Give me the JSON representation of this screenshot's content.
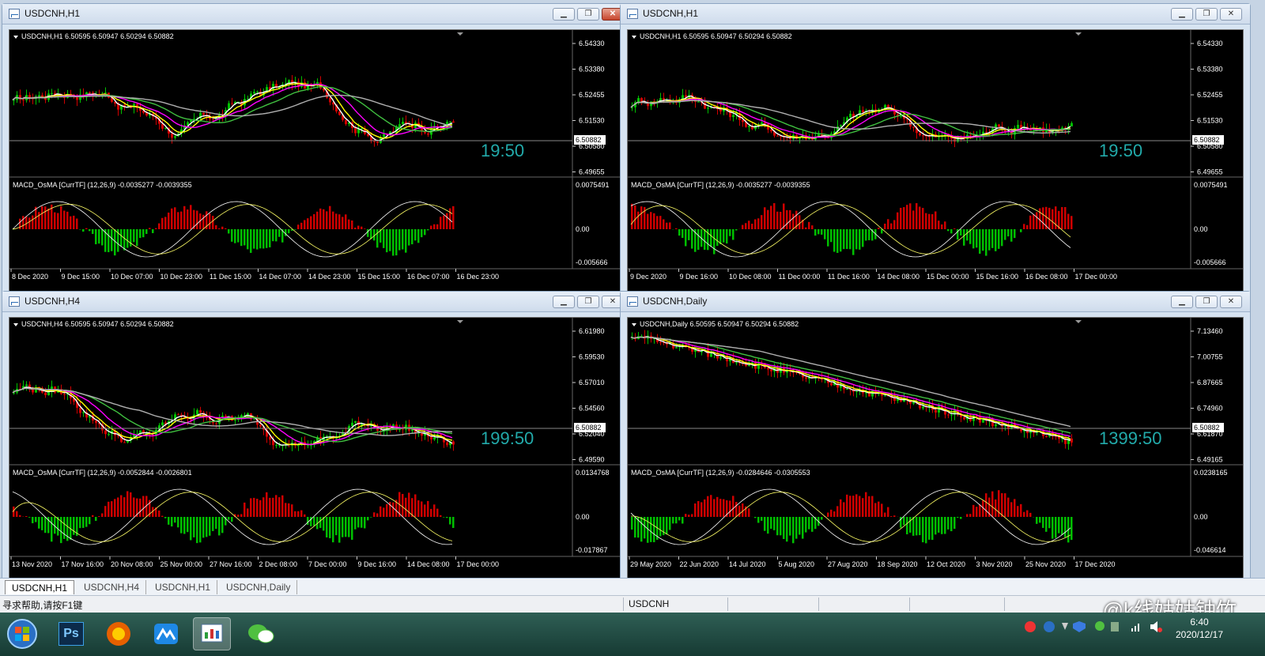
{
  "windows": [
    {
      "title": "USDCNH,H1",
      "header": "USDCNH,H1  6.50595 6.50947 6.50294 6.50882",
      "price_levels": [
        "6.54330",
        "6.53380",
        "6.52455",
        "6.51530",
        "6.50580",
        "6.49655"
      ],
      "current_price": "6.50882",
      "timer": "19:50",
      "macd_header": "MACD_OsMA [CurrTF] (12,26,9) -0.0035277 -0.0039355",
      "macd_levels": [
        "0.0075491",
        "0.00",
        "-0.005666"
      ],
      "time_labels": [
        "8 Dec 2020",
        "9 Dec 15:00",
        "10 Dec 07:00",
        "10 Dec 23:00",
        "11 Dec 15:00",
        "14 Dec 07:00",
        "14 Dec 23:00",
        "15 Dec 15:00",
        "16 Dec 07:00",
        "16 Dec 23:00"
      ],
      "active": true
    },
    {
      "title": "USDCNH,H1",
      "header": "USDCNH,H1  6.50595 6.50947 6.50294 6.50882",
      "price_levels": [
        "6.54330",
        "6.53380",
        "6.52455",
        "6.51530",
        "6.50580",
        "6.49655"
      ],
      "current_price": "6.50882",
      "timer": "19:50",
      "macd_header": "MACD_OsMA [CurrTF] (12,26,9) -0.0035277 -0.0039355",
      "macd_levels": [
        "0.0075491",
        "0.00",
        "-0.005666"
      ],
      "time_labels": [
        "9 Dec 2020",
        "9 Dec 16:00",
        "10 Dec 08:00",
        "11 Dec 00:00",
        "11 Dec 16:00",
        "14 Dec 08:00",
        "15 Dec 00:00",
        "15 Dec 16:00",
        "16 Dec 08:00",
        "17 Dec 00:00"
      ],
      "active": false
    },
    {
      "title": "USDCNH,H4",
      "header": "USDCNH,H4  6.50595 6.50947 6.50294 6.50882",
      "price_levels": [
        "6.61980",
        "6.59530",
        "6.57010",
        "6.54560",
        "6.52040",
        "6.49590"
      ],
      "current_price": "6.50882",
      "timer": "199:50",
      "macd_header": "MACD_OsMA [CurrTF] (12,26,9) -0.0052844 -0.0026801",
      "macd_levels": [
        "0.0134768",
        "0.00",
        "-0.017867"
      ],
      "time_labels": [
        "13 Nov 2020",
        "17 Nov 16:00",
        "20 Nov 08:00",
        "25 Nov 00:00",
        "27 Nov 16:00",
        "2 Dec 08:00",
        "7 Dec 00:00",
        "9 Dec 16:00",
        "14 Dec 08:00",
        "17 Dec 00:00"
      ],
      "active": false
    },
    {
      "title": "USDCNH,Daily",
      "header": "USDCNH,Daily  6.50595 6.50947 6.50294 6.50882",
      "price_levels": [
        "7.13460",
        "7.00755",
        "6.87665",
        "6.74960",
        "6.61870",
        "6.49165"
      ],
      "current_price": "6.50882",
      "timer": "1399:50",
      "macd_header": "MACD_OsMA [CurrTF] (12,26,9) -0.0284646 -0.0305553",
      "macd_levels": [
        "0.0238165",
        "0.00",
        "-0.046614"
      ],
      "time_labels": [
        "29 May 2020",
        "22 Jun 2020",
        "14 Jul 2020",
        "5 Aug 2020",
        "27 Aug 2020",
        "18 Sep 2020",
        "12 Oct 2020",
        "3 Nov 2020",
        "25 Nov 2020",
        "17 Dec 2020"
      ],
      "active": false
    }
  ],
  "window_controls": {
    "minimize": "▁",
    "restore": "❐",
    "close": "✕"
  },
  "tabs": [
    "USDCNH,H1",
    "USDCNH,H4",
    "USDCNH,H1",
    "USDCNH,Daily"
  ],
  "status": {
    "help": "寻求帮助,请按F1键",
    "symbol": "USDCNH"
  },
  "taskbar": {
    "icons": [
      "start-orb-icon",
      "photoshop-icon",
      "firefox-icon",
      "metatrader-icon",
      "chart-app-icon",
      "wechat-icon"
    ],
    "ps_label": "Ps",
    "time": "6:40",
    "date": "2020/12/17"
  },
  "watermark": "@k线姑姑钟竹",
  "colors": {
    "bull": "#00c000",
    "bear": "#d00000",
    "ma_white": "#ffffff",
    "ma_yellow": "#ffff00",
    "ma_magenta": "#ff00ff",
    "ma_green": "#40c040",
    "ma_gray": "#b0b0b0",
    "timer": "#22aaaa"
  }
}
